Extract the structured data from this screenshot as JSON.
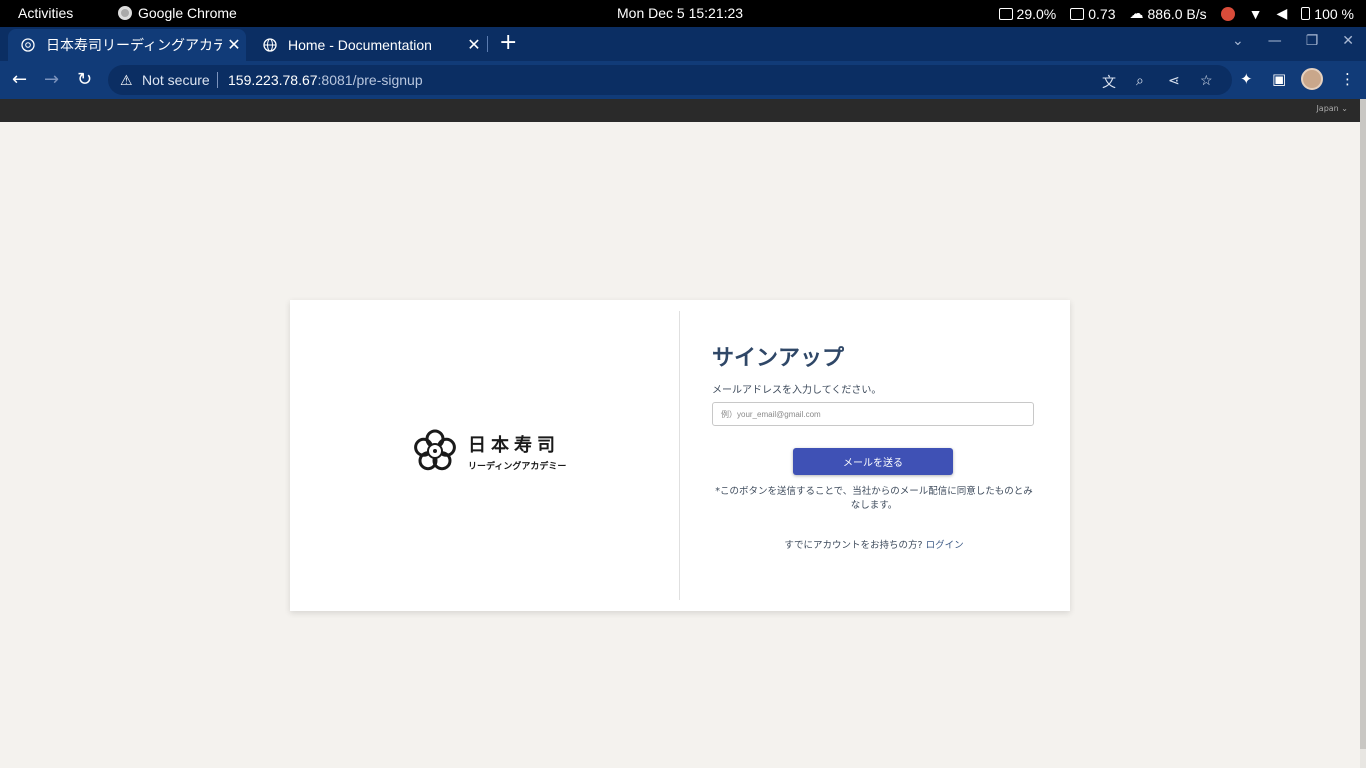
{
  "system_bar": {
    "activities": "Activities",
    "app_name": "Google Chrome",
    "clock": "Mon Dec 5  15:21:23",
    "cpu": "29.0%",
    "load": "0.73",
    "network": "886.0 B/s",
    "battery": "100 %"
  },
  "tabs": [
    {
      "title": "日本寿司リーディングアカデミー",
      "close": "✕"
    },
    {
      "title": "Home - Documentation",
      "close": "✕"
    }
  ],
  "new_tab": "+",
  "address_bar": {
    "security": "Not secure",
    "host": "159.223.78.67",
    "path": ":8081/pre-signup"
  },
  "site_header": {
    "language": "Japan"
  },
  "logo": {
    "main": "日本寿司",
    "sub": "リーディングアカデミー"
  },
  "form": {
    "title": "サインアップ",
    "label": "メールアドレスを入力してください。",
    "email_placeholder": "例）your_email@gmail.com",
    "submit": "メールを送る",
    "notice": "*このボタンを送信することで、当社からのメール配信に同意したものとみなします。",
    "login_prompt": "すでにアカウントをお持ちの方?",
    "login_link": "ログイン"
  },
  "colors": {
    "primary_button": "#3f51b5",
    "title_text": "#2f4767",
    "page_background": "#f4f2ee",
    "browser_frame": "#113b78"
  }
}
